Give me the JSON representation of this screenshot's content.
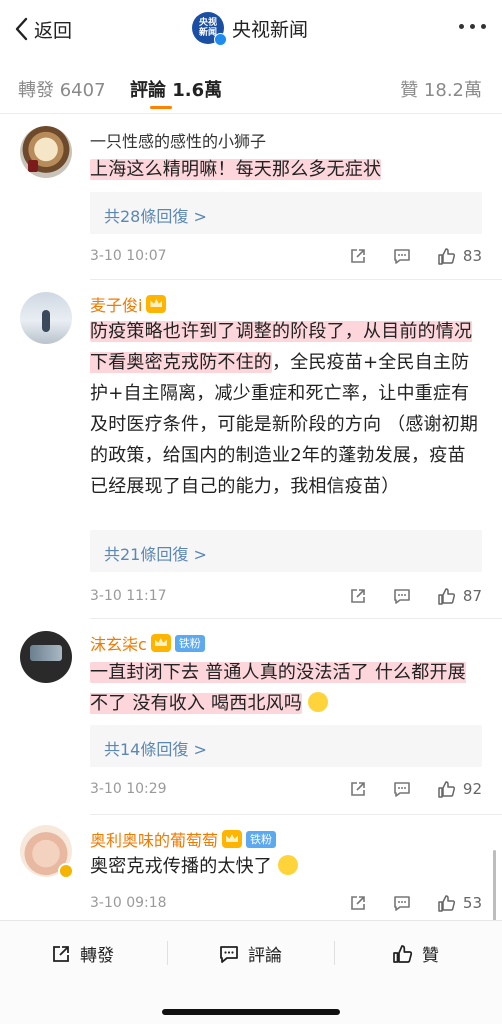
{
  "header": {
    "back_label": "返回",
    "channel_name": "央视新闻",
    "logo_text_top": "央视",
    "logo_text_bottom": "新闻"
  },
  "tabs": [
    {
      "label": "轉發 6407",
      "active": false
    },
    {
      "label": "評論 1.6萬",
      "active": true
    },
    {
      "label": "贊 18.2萬",
      "active": false
    }
  ],
  "comments": [
    {
      "user": "一只性感的感性的小狮子",
      "text": "上海这么精明嘛！每天那么多无症状",
      "replies": "共28條回復 >",
      "time": "3-10 10:07",
      "likes": "83"
    },
    {
      "user": "麦子俊i",
      "text_highlight": "防疫策略也许到了调整的阶段了，从目前的情况下看奥密克戎防不住的",
      "text_rest": "，全民疫苗+全民自主防护+自主隔离，减少重症和死亡率，让中重症有及时医疗条件，可能是新阶段的方向 （感谢初期的政策，给国内的制造业2年的蓬勃发展，疫苗已经展现了自己的能力，我相信疫苗）",
      "replies": "共21條回復 >",
      "time": "3-10 11:17",
      "likes": "87"
    },
    {
      "user": "沫玄柒c",
      "badge": "铁粉",
      "text": "一直封闭下去 普通人真的没法活了 什么都开展不了 没有收入 喝西北风吗",
      "replies": "共14條回復 >",
      "time": "3-10 10:29",
      "likes": "92"
    },
    {
      "user": "奥利奥味的葡萄萄",
      "badge": "铁粉",
      "text": "奥密克戎传播的太快了",
      "time": "3-10 09:18",
      "likes": "53"
    }
  ],
  "bottom_bar": {
    "repost": "轉發",
    "comment": "評論",
    "like": "贊"
  },
  "colors": {
    "accent": "#ff8200",
    "vip_name": "#f07a00",
    "link": "#5b87b4",
    "highlight": "#f9b4be"
  }
}
